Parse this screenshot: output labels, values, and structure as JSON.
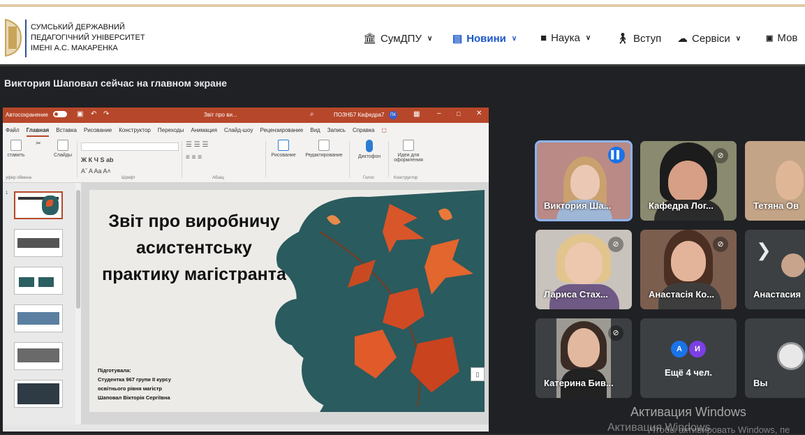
{
  "university": {
    "line1": "СУМСЬКИЙ ДЕРЖАВНИЙ",
    "line2": "ПЕДАГОГІЧНИЙ УНІВЕРСИТЕТ",
    "line3": "ІМЕНІ А.С. МАКАРЕНКА"
  },
  "nav": [
    {
      "label": "СумДПУ",
      "icon": "building-icon"
    },
    {
      "label": "Новини",
      "icon": "news-icon"
    },
    {
      "label": "Наука",
      "icon": "book-icon"
    },
    {
      "label": "Вступ",
      "icon": "person-icon"
    },
    {
      "label": "Сервіси",
      "icon": "cloud-icon"
    },
    {
      "label": "Мов",
      "icon": "language-icon"
    }
  ],
  "meet": {
    "presenting_text": "Виктория Шаповал сейчас на главном экране"
  },
  "ppt": {
    "autosave": "Автосохранение",
    "doc_title": "Звіт про ви...",
    "account": "ПОЗНБ7 Кафедра7",
    "account_initials": "ПК",
    "menu": [
      "Файл",
      "Главная",
      "Вставка",
      "Рисование",
      "Конструктор",
      "Переходы",
      "Анимация",
      "Слайд-шоу",
      "Рецензирование",
      "Вид",
      "Запись",
      "Справка"
    ],
    "ribbon": {
      "paste": "ставить",
      "slides": "Слайды",
      "clipboard": "уфер обмена",
      "font": "Шрифт",
      "paragraph": "Абзац",
      "drawing": "Рисование",
      "editing": "Редактирование",
      "dictate": "Диктофон",
      "voice": "Голос",
      "designer_ideas": "Идеи для оформления",
      "designer": "Конструктор"
    },
    "slide": {
      "title": "Звіт про виробничу асистентську практику магістранта",
      "footer_1": "Підготувала:",
      "footer_2": "Студентка 967 групи ІІ курсу",
      "footer_3": "освітнього рівня магістр",
      "footer_4": "Шаповал Вікторія Сергіївна"
    }
  },
  "participants": [
    {
      "name": "Виктория Ша...",
      "state": "speaking"
    },
    {
      "name": "Кафедра Лог...",
      "state": "muted"
    },
    {
      "name": "Тетяна Ов",
      "state": ""
    },
    {
      "name": "Лариса Стах...",
      "state": "muted"
    },
    {
      "name": "Анастасія Ко...",
      "state": "muted"
    },
    {
      "name": "Анастасия",
      "state": ""
    },
    {
      "name": "Катерина Бив...",
      "state": "muted"
    },
    {
      "name": "Ещё 4 чел.",
      "avatars": [
        "А",
        "И"
      ]
    },
    {
      "name": "Вы",
      "state": ""
    }
  ],
  "watermark": {
    "line1": "Активация Windows",
    "line2": "Активация Windows",
    "line3": "Чтобы активировать Windows, пе"
  },
  "colors": {
    "ppt_accent": "#b7472a",
    "meet_bg": "#202124",
    "speaking_outline": "#8ab4f8",
    "nav_active": "#1b56c7"
  }
}
